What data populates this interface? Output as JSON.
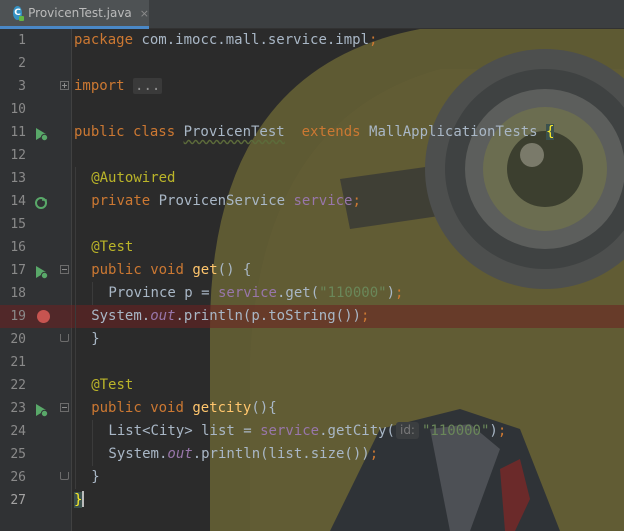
{
  "tab": {
    "title": "ProvicenTest.java",
    "close_glyph": "×",
    "icon_letter": "C"
  },
  "colors": {
    "keyword": "#cc7832",
    "annotation": "#bbb529",
    "method": "#ffc66d",
    "field": "#9876aa",
    "string": "#6a8759",
    "text": "#a9b7c6",
    "breakpoint": "#c75450",
    "run_icon": "#59a869"
  },
  "lines": [
    {
      "n": "1",
      "indent": 0,
      "tokens": [
        [
          "kw",
          "package "
        ],
        [
          "pl",
          "com.imocc.mall.service.impl"
        ],
        [
          "kw",
          ";"
        ]
      ]
    },
    {
      "n": "2",
      "indent": 0,
      "tokens": []
    },
    {
      "n": "3",
      "indent": 0,
      "fold": "plus",
      "tokens": [
        [
          "kw",
          "import "
        ],
        [
          "dots",
          "..."
        ]
      ]
    },
    {
      "n": "10",
      "indent": 0,
      "tokens": []
    },
    {
      "n": "11",
      "indent": 0,
      "gutter": "run",
      "tokens": [
        [
          "kw",
          "public class "
        ],
        [
          "ul",
          "ProvicenTest"
        ],
        [
          "pl",
          "  "
        ],
        [
          "kw",
          "extends "
        ],
        [
          "pl",
          "MallApplicationTests "
        ],
        [
          "brace",
          "{"
        ]
      ]
    },
    {
      "n": "12",
      "indent": 0,
      "tokens": []
    },
    {
      "n": "13",
      "indent": 1,
      "tokens": [
        [
          "an",
          "@Autowired"
        ]
      ]
    },
    {
      "n": "14",
      "indent": 1,
      "gutter": "bean",
      "tokens": [
        [
          "kw",
          "private "
        ],
        [
          "pl",
          "ProvicenService "
        ],
        [
          "fi",
          "service"
        ],
        [
          "kw",
          ";"
        ]
      ]
    },
    {
      "n": "15",
      "indent": 1,
      "tokens": []
    },
    {
      "n": "16",
      "indent": 1,
      "tokens": [
        [
          "an",
          "@Test"
        ]
      ]
    },
    {
      "n": "17",
      "indent": 1,
      "gutter": "run",
      "fold": "minus",
      "tokens": [
        [
          "kw",
          "public void "
        ],
        [
          "fn",
          "get"
        ],
        [
          "pl",
          "() {"
        ]
      ]
    },
    {
      "n": "18",
      "indent": 2,
      "tokens": [
        [
          "pl",
          "Province p = "
        ],
        [
          "fi",
          "service"
        ],
        [
          "pl",
          ".get("
        ],
        [
          "st",
          "\"110000\""
        ],
        [
          "pl",
          ")"
        ],
        [
          "kw",
          ";"
        ]
      ]
    },
    {
      "n": "19",
      "indent": 1,
      "bp": true,
      "tokens": [
        [
          "pl",
          "System."
        ],
        [
          "fii",
          "out"
        ],
        [
          "pl",
          ".println(p.toString())"
        ],
        [
          "kw",
          ";"
        ]
      ]
    },
    {
      "n": "20",
      "indent": 1,
      "fold": "end",
      "tokens": [
        [
          "pl",
          "}"
        ]
      ]
    },
    {
      "n": "21",
      "indent": 1,
      "tokens": []
    },
    {
      "n": "22",
      "indent": 1,
      "tokens": [
        [
          "an",
          "@Test"
        ]
      ]
    },
    {
      "n": "23",
      "indent": 1,
      "gutter": "run",
      "fold": "minus",
      "tokens": [
        [
          "kw",
          "public void "
        ],
        [
          "fn",
          "getcity"
        ],
        [
          "pl",
          "(){"
        ]
      ]
    },
    {
      "n": "24",
      "indent": 2,
      "tokens": [
        [
          "pl",
          "List<City> list = "
        ],
        [
          "fi",
          "service"
        ],
        [
          "pl",
          ".getCity("
        ],
        [
          "hint",
          "id:"
        ],
        [
          "st",
          "\"110000\""
        ],
        [
          "pl",
          ")"
        ],
        [
          "kw",
          ";"
        ]
      ]
    },
    {
      "n": "25",
      "indent": 2,
      "tokens": [
        [
          "pl",
          "System."
        ],
        [
          "fii",
          "out"
        ],
        [
          "pl",
          ".println(list.size())"
        ],
        [
          "kw",
          ";"
        ]
      ]
    },
    {
      "n": "26",
      "indent": 1,
      "fold": "end",
      "tokens": [
        [
          "pl",
          "}"
        ]
      ]
    },
    {
      "n": "27",
      "indent": 0,
      "current": true,
      "tokens": [
        [
          "brace",
          "}"
        ]
      ]
    }
  ]
}
